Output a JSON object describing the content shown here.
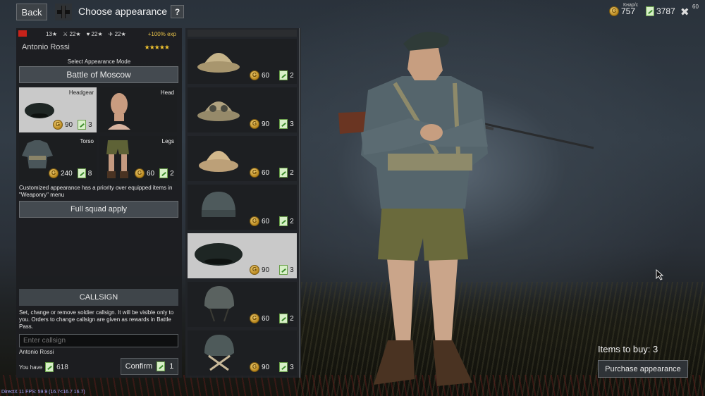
{
  "topbar": {
    "back_label": "Back",
    "title": "Choose appearance",
    "help_label": "?",
    "gold_amount": "757",
    "tickets_amount": "3787",
    "close_count": "60",
    "small_text": "Кнар/с"
  },
  "soldier": {
    "stats": [
      "13",
      "22",
      "22",
      "22"
    ],
    "exp_bonus": "+100% exp",
    "name": "Antonio Rossi",
    "stars": "★★★★★"
  },
  "appearance": {
    "mode_label": "Select Appearance Mode",
    "mode_value": "Battle of Moscow",
    "slots": [
      {
        "label": "Headgear",
        "gold": "90",
        "tickets": "3"
      },
      {
        "label": "Head"
      },
      {
        "label": "Torso",
        "gold": "240",
        "tickets": "8"
      },
      {
        "label": "Legs",
        "gold": "60",
        "tickets": "2"
      }
    ],
    "note": "Customized appearance has a priority over equipped items in \"Weaponry\" menu",
    "squad_apply_label": "Full squad apply"
  },
  "callsign": {
    "header": "CALLSIGN",
    "description": "Set, change or remove soldier callsign. It will be visible only to you. Orders to change callsign are given as rewards in Battle Pass.",
    "placeholder": "Enter callsign",
    "current": "Antonio Rossi",
    "you_have_label": "You have",
    "you_have_amount": "618",
    "confirm_label": "Confirm",
    "confirm_cost": "1"
  },
  "items": [
    {
      "gold": "60",
      "tickets": "2",
      "icon": "pith-helmet-icon"
    },
    {
      "gold": "90",
      "tickets": "3",
      "icon": "pith-helmet-goggles-icon"
    },
    {
      "gold": "60",
      "tickets": "2",
      "icon": "pith-helmet-tan-icon"
    },
    {
      "gold": "60",
      "tickets": "2",
      "icon": "field-cap-icon"
    },
    {
      "gold": "90",
      "tickets": "3",
      "icon": "beret-icon",
      "selected": true
    },
    {
      "gold": "60",
      "tickets": "2",
      "icon": "steel-helmet-icon"
    },
    {
      "gold": "90",
      "tickets": "3",
      "icon": "steel-helmet-net-icon"
    }
  ],
  "purchase": {
    "items_to_buy": "Items to buy: 3",
    "button_label": "Purchase appearance"
  },
  "debug": {
    "fps_text": "DirectX 11 FPS: 59.9 (16.7<16.7 16.7)"
  },
  "colors": {
    "gold_star": "#f0c330",
    "exp_text": "#e9c34a",
    "selected_tile": "#c9c9c9",
    "panel_bg": "#1c1e20"
  }
}
